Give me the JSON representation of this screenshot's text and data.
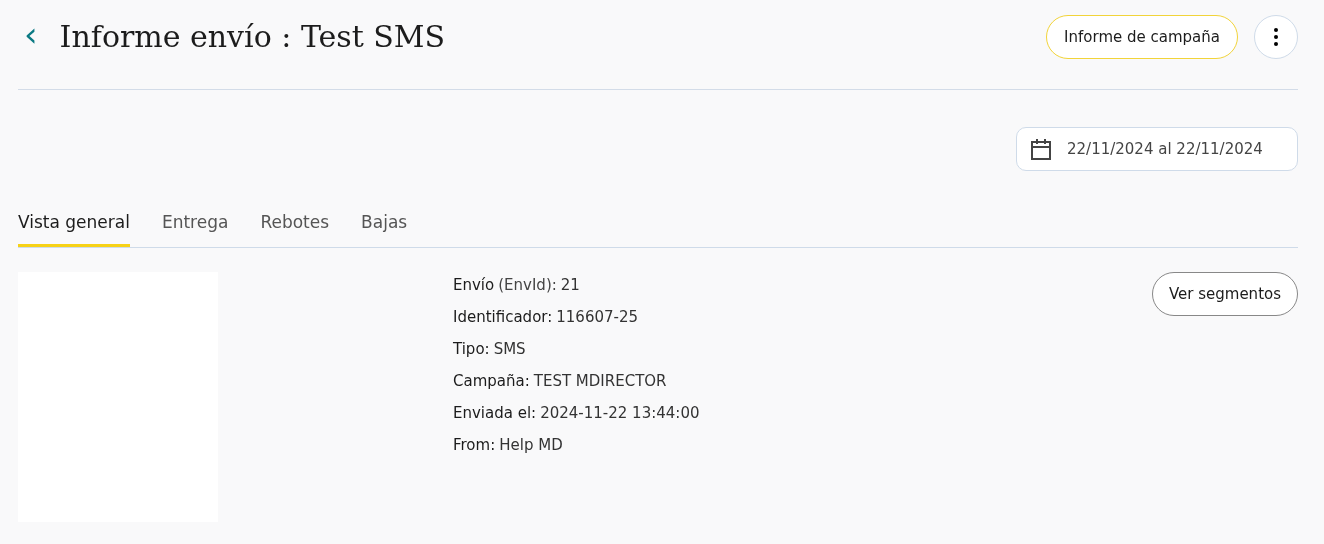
{
  "header": {
    "back": "‹",
    "title": "Informe envío : Test SMS",
    "report_button": "Informe de campaña"
  },
  "date_range": {
    "value": "22/11/2024 al 22/11/2024"
  },
  "tabs": [
    {
      "label": "Vista general",
      "selected": true
    },
    {
      "label": "Entrega",
      "selected": false
    },
    {
      "label": "Rebotes",
      "selected": false
    },
    {
      "label": "Bajas",
      "selected": false
    }
  ],
  "details": [
    {
      "label": "Envío",
      "note": "(EnvId):",
      "value": "21"
    },
    {
      "label": "Identificador:",
      "value": "116607-25"
    },
    {
      "label": "Tipo:",
      "value": "SMS"
    },
    {
      "label": "Campaña:",
      "value": "TEST MDIRECTOR"
    },
    {
      "label": "Enviada el:",
      "value": "2024-11-22 13:44:00"
    },
    {
      "label": "From:",
      "value": "Help MD"
    }
  ],
  "segments_button": "Ver segmentos"
}
